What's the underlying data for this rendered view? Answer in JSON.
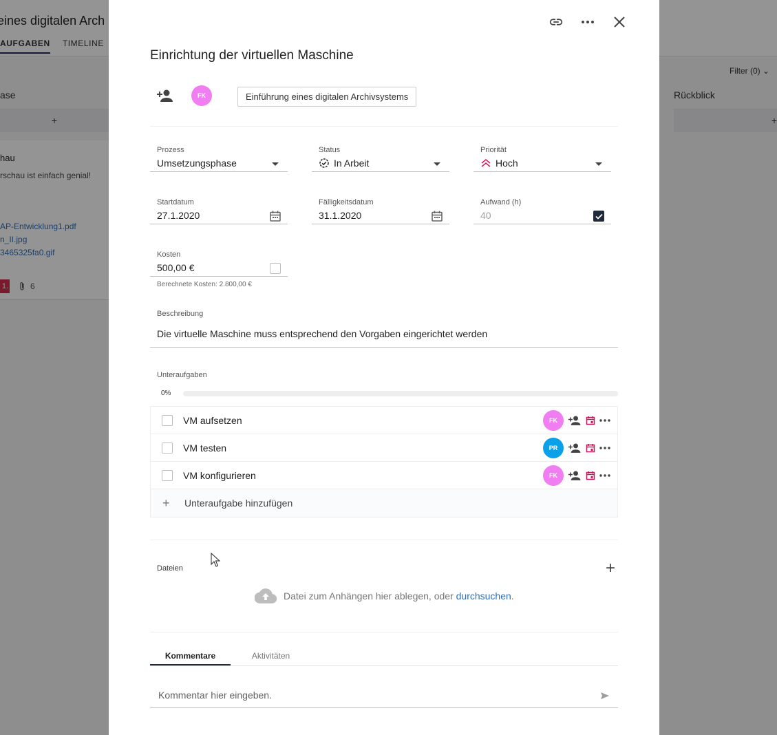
{
  "background": {
    "board_title": "eines digitalen Arch",
    "tabs": [
      "AUFGABEN",
      "TIMELINE"
    ],
    "filter": "Filter (0)",
    "col_left_title": "ase",
    "col_right_title": "Rückblick",
    "add_symbol": "+",
    "card": {
      "title": "hau",
      "text": "rschau ist einfach genial!",
      "links": [
        "AP-Entwicklung1.pdf",
        "n_II.jpg",
        "3465325fa0.gif"
      ],
      "badge": "1.",
      "attachments": "6"
    }
  },
  "modal": {
    "title": "Einrichtung der virtuellen Maschine",
    "assignee_initials": "FK",
    "project": "Einführung eines digitalen Archivsystems",
    "fields": {
      "prozess": {
        "label": "Prozess",
        "value": "Umsetzungsphase"
      },
      "status": {
        "label": "Status",
        "value": "In Arbeit"
      },
      "prioritaet": {
        "label": "Priorität",
        "value": "Hoch"
      },
      "startdatum": {
        "label": "Startdatum",
        "value": "27.1.2020"
      },
      "faelligkeit": {
        "label": "Fälligkeitsdatum",
        "value": "31.1.2020"
      },
      "aufwand": {
        "label": "Aufwand (h)",
        "value": "40"
      },
      "kosten": {
        "label": "Kosten",
        "value": "500,00 €"
      }
    },
    "calculated_costs": "Berechnete Kosten: 2.800,00 €",
    "description": {
      "label": "Beschreibung",
      "value": "Die virtuelle Maschine muss entsprechend den Vorgaben eingerichtet werden"
    },
    "subtasks": {
      "label": "Unteraufgaben",
      "progress_text": "0%",
      "progress_value": 0,
      "items": [
        {
          "name": "VM aufsetzen",
          "assignee": "FK"
        },
        {
          "name": "VM testen",
          "assignee": "PR"
        },
        {
          "name": "VM konfigurieren",
          "assignee": "FK"
        }
      ],
      "add_label": "Unteraufgabe hinzufügen"
    },
    "files": {
      "label": "Dateien",
      "drop_text": "Datei zum Anhängen hier ablegen, oder",
      "browse_link": "durchsuchen",
      "drop_end": "."
    },
    "tabs": [
      "Kommentare",
      "Aktivitäten"
    ],
    "comment_placeholder": "Kommentar hier eingeben."
  },
  "colors": {
    "avatar_fk": "#f07ef0",
    "avatar_pr": "#0aa1e8",
    "priority_high": "#d81b60",
    "date_icon_red": "#c2185b",
    "link": "#2f6db5"
  }
}
